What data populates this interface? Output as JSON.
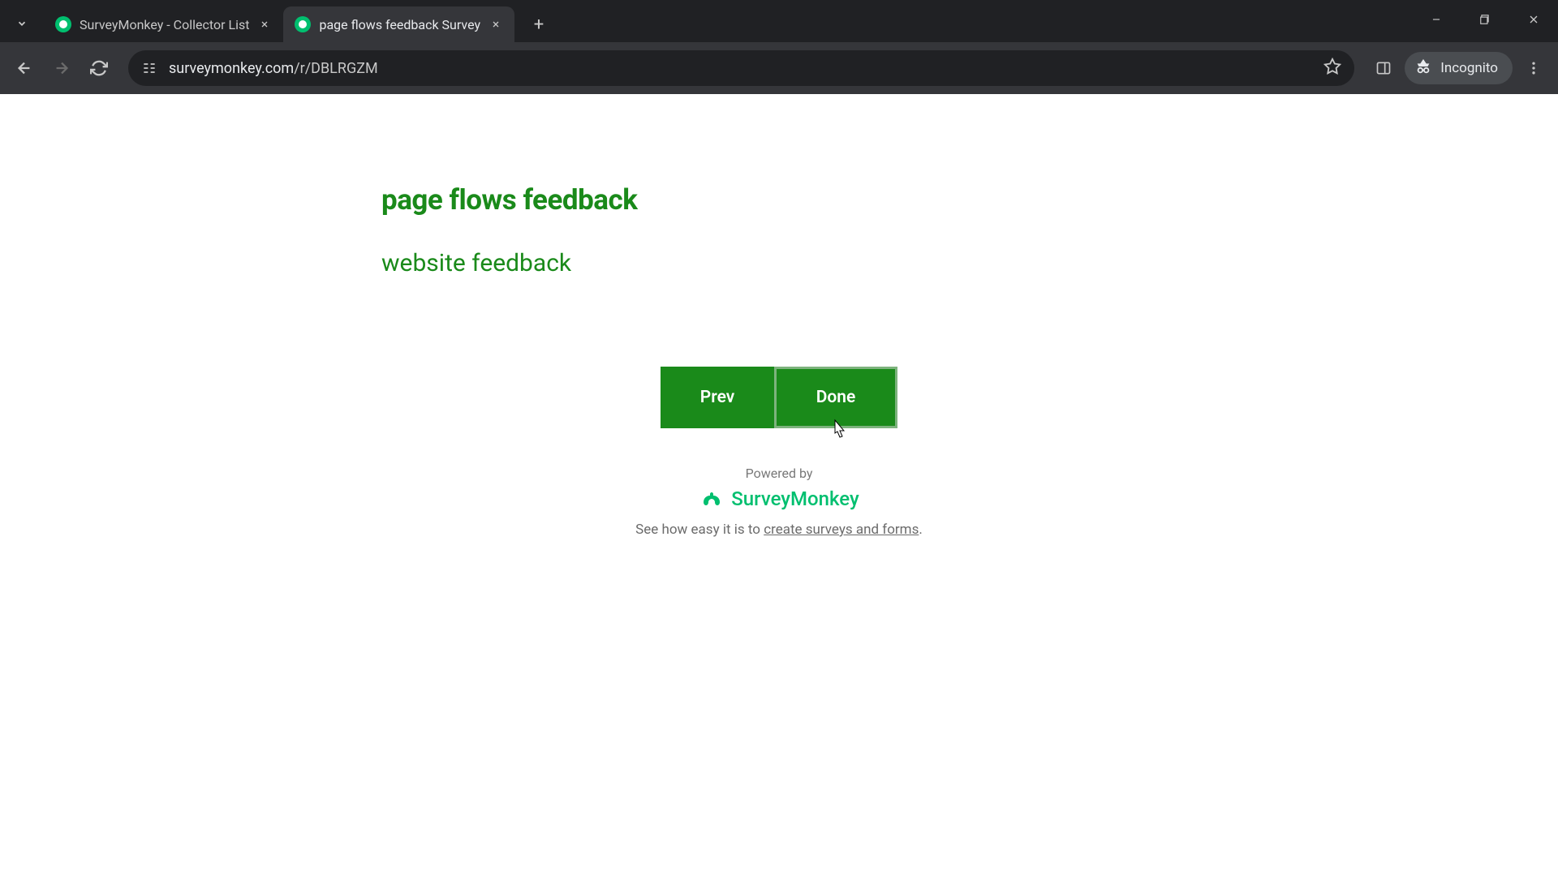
{
  "browser": {
    "tabs": [
      {
        "title": "SurveyMonkey - Collector List",
        "active": false
      },
      {
        "title": "page flows feedback Survey",
        "active": true
      }
    ],
    "url_prefix": "surveymonkey.com",
    "url_path": "/r/DBLRGZM",
    "incognito_label": "Incognito"
  },
  "survey": {
    "title": "page flows feedback",
    "subtitle": "website feedback",
    "prev_label": "Prev",
    "done_label": "Done"
  },
  "footer": {
    "powered_by": "Powered by",
    "brand": "SurveyMonkey",
    "see_text": "See how easy it is to ",
    "link_text": "create surveys and forms",
    "period": "."
  }
}
